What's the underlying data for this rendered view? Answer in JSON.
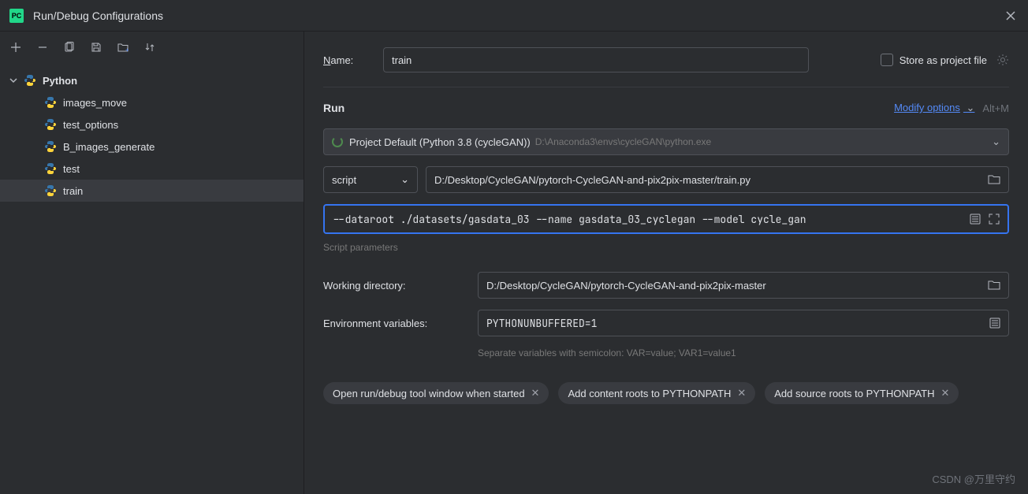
{
  "titlebar": {
    "title": "Run/Debug Configurations"
  },
  "tree": {
    "root": "Python",
    "items": [
      "images_move",
      "test_options",
      "B_images_generate",
      "test",
      "train"
    ],
    "selected": "train"
  },
  "name": {
    "label": "Name:",
    "value": "train"
  },
  "store_project": "Store as project file",
  "run_section": "Run",
  "modify": "Modify options",
  "modify_shortcut": "Alt+M",
  "interpreter": {
    "label": "Project Default (Python 3.8 (cycleGAN))",
    "path": "D:\\Anaconda3\\envs\\cycleGAN\\python.exe"
  },
  "script_type": "script",
  "script_path": "D:/Desktop/CycleGAN/pytorch-CycleGAN-and-pix2pix-master/train.py",
  "script_params": "--dataroot ./datasets/gasdata_03 --name gasdata_03_cyclegan --model cycle_gan",
  "params_hint": "Script parameters",
  "working_dir": {
    "label": "Working directory:",
    "value": "D:/Desktop/CycleGAN/pytorch-CycleGAN-and-pix2pix-master"
  },
  "env_vars": {
    "label": "Environment variables:",
    "value": "PYTHONUNBUFFERED=1",
    "hint": "Separate variables with semicolon: VAR=value; VAR1=value1"
  },
  "chips": [
    "Open run/debug tool window when started",
    "Add content roots to PYTHONPATH",
    "Add source roots to PYTHONPATH"
  ],
  "watermark": "CSDN @万里守约"
}
